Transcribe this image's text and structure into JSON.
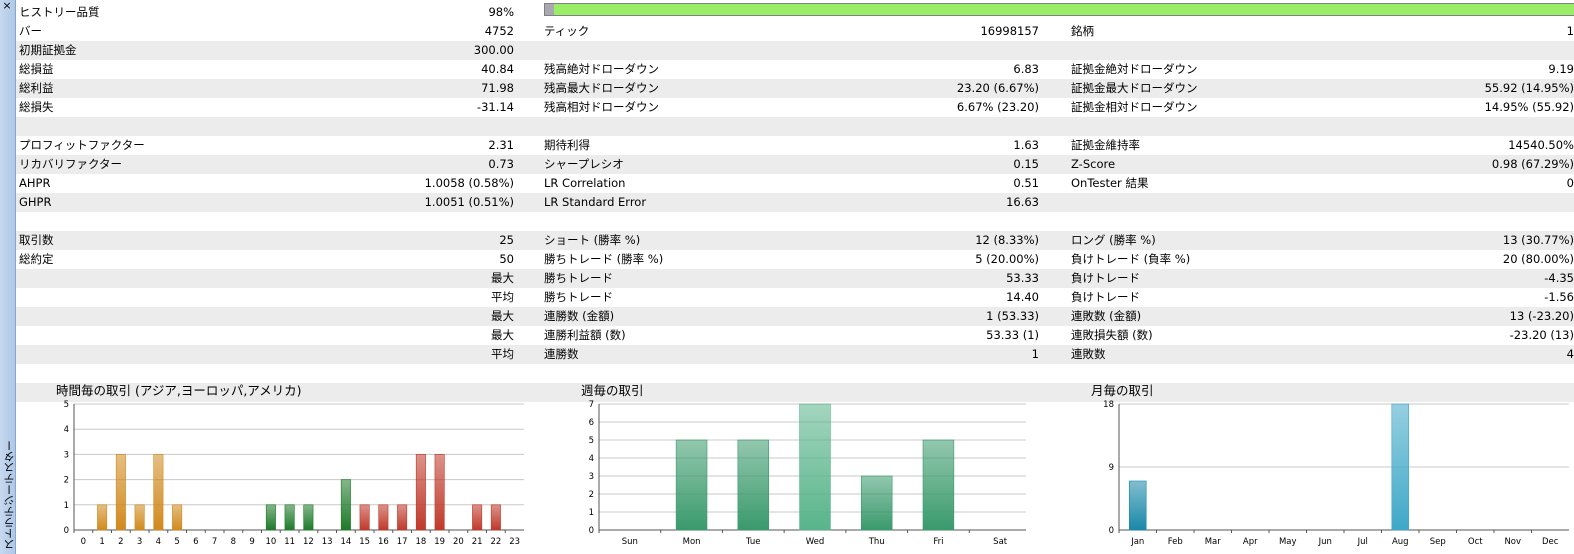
{
  "sidebar": {
    "close_glyph": "×",
    "panel_title": "ストラテジーテスター"
  },
  "quality": {
    "label": "ヒストリー品質",
    "value": "98%",
    "fraction": 0.98
  },
  "rows": [
    {
      "shade": false,
      "cells": [
        "バー",
        "4752",
        "ティック",
        "16998157",
        "銘柄",
        "1"
      ]
    },
    {
      "shade": true,
      "cells": [
        "初期証拠金",
        "300.00",
        "",
        "",
        "",
        ""
      ]
    },
    {
      "shade": false,
      "cells": [
        "総損益",
        "40.84",
        "残高絶対ドローダウン",
        "6.83",
        "証拠金絶対ドローダウン",
        "9.19"
      ]
    },
    {
      "shade": true,
      "cells": [
        "総利益",
        "71.98",
        "残高最大ドローダウン",
        "23.20 (6.67%)",
        "証拠金最大ドローダウン",
        "55.92 (14.95%)"
      ]
    },
    {
      "shade": false,
      "cells": [
        "総損失",
        "-31.14",
        "残高相対ドローダウン",
        "6.67% (23.20)",
        "証拠金相対ドローダウン",
        "14.95% (55.92)"
      ]
    },
    {
      "shade": true,
      "cells": [
        "",
        "",
        "",
        "",
        "",
        ""
      ]
    },
    {
      "shade": false,
      "cells": [
        "プロフィットファクター",
        "2.31",
        "期待利得",
        "1.63",
        "証拠金維持率",
        "14540.50%"
      ]
    },
    {
      "shade": true,
      "cells": [
        "リカバリファクター",
        "0.73",
        "シャープレシオ",
        "0.15",
        "Z-Score",
        "0.98 (67.29%)"
      ]
    },
    {
      "shade": false,
      "cells": [
        "AHPR",
        "1.0058 (0.58%)",
        "LR Correlation",
        "0.51",
        "OnTester 結果",
        "0"
      ]
    },
    {
      "shade": true,
      "cells": [
        "GHPR",
        "1.0051 (0.51%)",
        "LR Standard Error",
        "16.63",
        "",
        ""
      ]
    },
    {
      "shade": false,
      "cells": [
        "",
        "",
        "",
        "",
        "",
        ""
      ]
    },
    {
      "shade": true,
      "cells": [
        "取引数",
        "25",
        "ショート (勝率 %)",
        "12 (8.33%)",
        "ロング (勝率 %)",
        "13 (30.77%)"
      ]
    },
    {
      "shade": false,
      "cells": [
        "総約定",
        "50",
        "勝ちトレード (勝率 %)",
        "5 (20.00%)",
        "負けトレード (負率 %)",
        "20 (80.00%)"
      ]
    },
    {
      "shade": true,
      "cells": [
        "",
        "最大",
        "勝ちトレード",
        "53.33",
        "負けトレード",
        "-4.35"
      ]
    },
    {
      "shade": false,
      "cells": [
        "",
        "平均",
        "勝ちトレード",
        "14.40",
        "負けトレード",
        "-1.56"
      ]
    },
    {
      "shade": true,
      "cells": [
        "",
        "最大",
        "連勝数 (金額)",
        "1 (53.33)",
        "連敗数 (金額)",
        "13 (-23.20)"
      ]
    },
    {
      "shade": false,
      "cells": [
        "",
        "最大",
        "連勝利益額 (数)",
        "53.33 (1)",
        "連敗損失額 (数)",
        "-23.20 (13)"
      ]
    },
    {
      "shade": true,
      "cells": [
        "",
        "平均",
        "連勝数",
        "1",
        "連敗数",
        "4"
      ]
    },
    {
      "shade": false,
      "cells": [
        "",
        "",
        "",
        "",
        "",
        ""
      ]
    },
    {
      "shade": true,
      "cells": [
        "",
        "",
        "",
        "",
        "",
        ""
      ]
    }
  ],
  "chart_data": [
    {
      "type": "bar",
      "title": "時間毎の取引 (アジア,ヨーロッパ,アメリカ)",
      "categories": [
        "0",
        "1",
        "2",
        "3",
        "4",
        "5",
        "6",
        "7",
        "8",
        "9",
        "10",
        "11",
        "12",
        "13",
        "14",
        "15",
        "16",
        "17",
        "18",
        "19",
        "20",
        "21",
        "22",
        "23"
      ],
      "values": [
        0,
        1,
        3,
        1,
        3,
        1,
        0,
        0,
        0,
        0,
        1,
        1,
        1,
        0,
        2,
        1,
        1,
        1,
        3,
        3,
        0,
        1,
        1,
        0
      ],
      "bar_colors": [
        "#d08a1e",
        "#d08a1e",
        "#d08a1e",
        "#d08a1e",
        "#d08a1e",
        "#d08a1e",
        "#d08a1e",
        "#d08a1e",
        "#d08a1e",
        "#1f7a2a",
        "#1f7a2a",
        "#1f7a2a",
        "#1f7a2a",
        "#1f7a2a",
        "#1f7a2a",
        "#c0392b",
        "#c0392b",
        "#c0392b",
        "#c0392b",
        "#c0392b",
        "#c0392b",
        "#c0392b",
        "#c0392b",
        "#c0392b"
      ],
      "yticks": [
        0,
        1,
        2,
        3,
        4,
        5
      ],
      "ylim": [
        0,
        5
      ],
      "grid": true
    },
    {
      "type": "bar",
      "title": "週毎の取引",
      "categories": [
        "Sun",
        "Mon",
        "Tue",
        "Wed",
        "Thu",
        "Fri",
        "Sat"
      ],
      "values": [
        0,
        5,
        5,
        7,
        3,
        5,
        0
      ],
      "bar_colors": [
        "#3a9a6c",
        "#3a9a6c",
        "#3a9a6c",
        "#58b48a",
        "#3a9a6c",
        "#3a9a6c",
        "#3a9a6c"
      ],
      "yticks": [
        0,
        1,
        2,
        3,
        4,
        5,
        6,
        7
      ],
      "ylim": [
        0,
        7
      ],
      "grid": true
    },
    {
      "type": "bar",
      "title": "月毎の取引",
      "categories": [
        "Jan",
        "Feb",
        "Mar",
        "Apr",
        "May",
        "Jun",
        "Jul",
        "Aug",
        "Sep",
        "Oct",
        "Nov",
        "Dec"
      ],
      "values": [
        7,
        0,
        0,
        0,
        0,
        0,
        0,
        18,
        0,
        0,
        0,
        0
      ],
      "bar_colors": [
        "#1a88a8",
        "#1a88a8",
        "#1a88a8",
        "#1a88a8",
        "#1a88a8",
        "#1a88a8",
        "#1a88a8",
        "#3fa8c8",
        "#1a88a8",
        "#1a88a8",
        "#1a88a8",
        "#1a88a8"
      ],
      "yticks": [
        0,
        9,
        18
      ],
      "ylim": [
        0,
        18
      ],
      "grid": true
    }
  ]
}
